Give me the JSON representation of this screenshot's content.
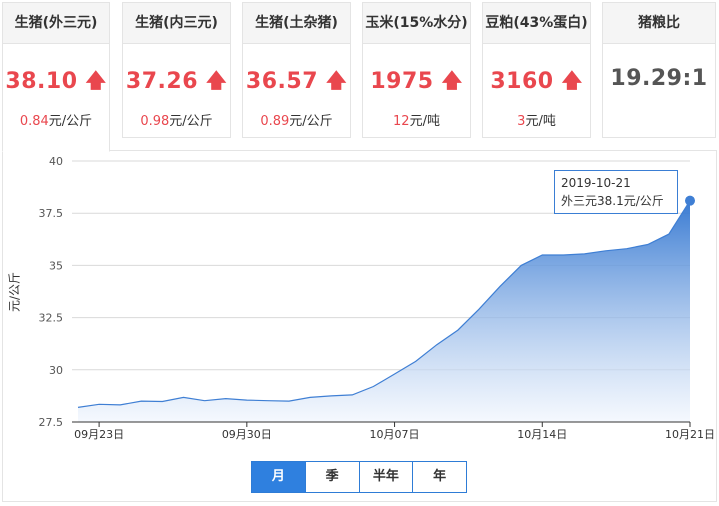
{
  "cards": [
    {
      "title": "生猪(外三元)",
      "price": "38.10",
      "arrow": "🡅",
      "change_num": "0.84",
      "change_unit": "元/公斤"
    },
    {
      "title": "生猪(内三元)",
      "price": "37.26",
      "arrow": "🡅",
      "change_num": "0.98",
      "change_unit": "元/公斤"
    },
    {
      "title": "生猪(土杂猪)",
      "price": "36.57",
      "arrow": "🡅",
      "change_num": "0.89",
      "change_unit": "元/公斤"
    },
    {
      "title": "玉米(15%水分)",
      "price": "1975",
      "arrow": "🡅",
      "change_num": "12",
      "change_unit": "元/吨"
    },
    {
      "title": "豆粕(43%蛋白)",
      "price": "3160",
      "arrow": "🡅",
      "change_num": "3",
      "change_unit": "元/吨"
    },
    {
      "title": "猪粮比",
      "price": "19.29:1"
    }
  ],
  "tooltip": {
    "date": "2019-10-21",
    "text": "外三元38.1元/公斤"
  },
  "range_tabs": [
    "月",
    "季",
    "半年",
    "年"
  ],
  "active_range": "月",
  "colors": {
    "line": "#3f7fd4",
    "accent_red": "#e9474e",
    "tab_active": "#2f80df"
  },
  "chart_data": {
    "type": "area",
    "ylabel": "元/公斤",
    "ylim": [
      27.5,
      40
    ],
    "yticks": [
      "40",
      "37.5",
      "35",
      "32.5",
      "30",
      "27.5"
    ],
    "ytick_values": [
      40,
      37.5,
      35,
      32.5,
      30,
      27.5
    ],
    "xticks": [
      {
        "label": "09月23日",
        "index": 1
      },
      {
        "label": "09月30日",
        "index": 8
      },
      {
        "label": "10月07日",
        "index": 15
      },
      {
        "label": "10月14日",
        "index": 22
      },
      {
        "label": "10月21日",
        "index": 29
      }
    ],
    "series": [
      {
        "x": [
          "09-22",
          "09-23",
          "09-24",
          "09-25",
          "09-26",
          "09-27",
          "09-28",
          "09-29",
          "09-30",
          "10-01",
          "10-02",
          "10-03",
          "10-04",
          "10-05",
          "10-06",
          "10-07",
          "10-08",
          "10-09",
          "10-10",
          "10-11",
          "10-12",
          "10-13",
          "10-14",
          "10-15",
          "10-16",
          "10-17",
          "10-18",
          "10-19",
          "10-20",
          "10-21"
        ],
        "values": [
          28.2,
          28.35,
          28.32,
          28.5,
          28.48,
          28.68,
          28.52,
          28.62,
          28.55,
          28.52,
          28.5,
          28.68,
          28.75,
          28.8,
          29.2,
          29.8,
          30.4,
          31.2,
          31.9,
          32.9,
          34.0,
          35.0,
          35.5,
          35.5,
          35.55,
          35.7,
          35.8,
          36.0,
          36.5,
          38.1
        ]
      }
    ]
  }
}
